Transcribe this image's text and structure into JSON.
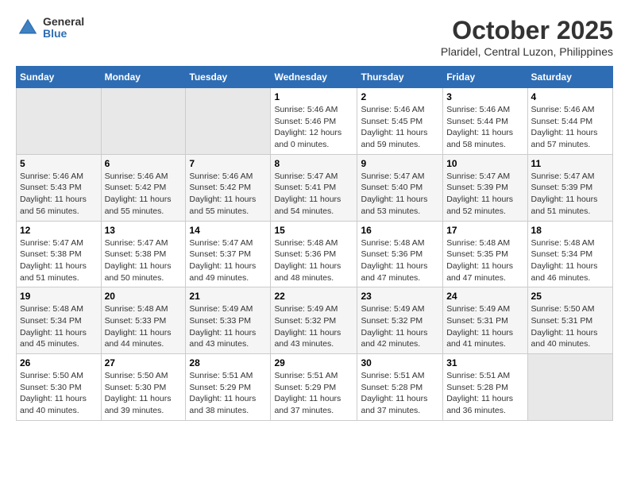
{
  "header": {
    "logo_general": "General",
    "logo_blue": "Blue",
    "month_title": "October 2025",
    "subtitle": "Plaridel, Central Luzon, Philippines"
  },
  "days_of_week": [
    "Sunday",
    "Monday",
    "Tuesday",
    "Wednesday",
    "Thursday",
    "Friday",
    "Saturday"
  ],
  "weeks": [
    [
      {
        "day": "",
        "info": ""
      },
      {
        "day": "",
        "info": ""
      },
      {
        "day": "",
        "info": ""
      },
      {
        "day": "1",
        "info": "Sunrise: 5:46 AM\nSunset: 5:46 PM\nDaylight: 12 hours\nand 0 minutes."
      },
      {
        "day": "2",
        "info": "Sunrise: 5:46 AM\nSunset: 5:45 PM\nDaylight: 11 hours\nand 59 minutes."
      },
      {
        "day": "3",
        "info": "Sunrise: 5:46 AM\nSunset: 5:44 PM\nDaylight: 11 hours\nand 58 minutes."
      },
      {
        "day": "4",
        "info": "Sunrise: 5:46 AM\nSunset: 5:44 PM\nDaylight: 11 hours\nand 57 minutes."
      }
    ],
    [
      {
        "day": "5",
        "info": "Sunrise: 5:46 AM\nSunset: 5:43 PM\nDaylight: 11 hours\nand 56 minutes."
      },
      {
        "day": "6",
        "info": "Sunrise: 5:46 AM\nSunset: 5:42 PM\nDaylight: 11 hours\nand 55 minutes."
      },
      {
        "day": "7",
        "info": "Sunrise: 5:46 AM\nSunset: 5:42 PM\nDaylight: 11 hours\nand 55 minutes."
      },
      {
        "day": "8",
        "info": "Sunrise: 5:47 AM\nSunset: 5:41 PM\nDaylight: 11 hours\nand 54 minutes."
      },
      {
        "day": "9",
        "info": "Sunrise: 5:47 AM\nSunset: 5:40 PM\nDaylight: 11 hours\nand 53 minutes."
      },
      {
        "day": "10",
        "info": "Sunrise: 5:47 AM\nSunset: 5:39 PM\nDaylight: 11 hours\nand 52 minutes."
      },
      {
        "day": "11",
        "info": "Sunrise: 5:47 AM\nSunset: 5:39 PM\nDaylight: 11 hours\nand 51 minutes."
      }
    ],
    [
      {
        "day": "12",
        "info": "Sunrise: 5:47 AM\nSunset: 5:38 PM\nDaylight: 11 hours\nand 51 minutes."
      },
      {
        "day": "13",
        "info": "Sunrise: 5:47 AM\nSunset: 5:38 PM\nDaylight: 11 hours\nand 50 minutes."
      },
      {
        "day": "14",
        "info": "Sunrise: 5:47 AM\nSunset: 5:37 PM\nDaylight: 11 hours\nand 49 minutes."
      },
      {
        "day": "15",
        "info": "Sunrise: 5:48 AM\nSunset: 5:36 PM\nDaylight: 11 hours\nand 48 minutes."
      },
      {
        "day": "16",
        "info": "Sunrise: 5:48 AM\nSunset: 5:36 PM\nDaylight: 11 hours\nand 47 minutes."
      },
      {
        "day": "17",
        "info": "Sunrise: 5:48 AM\nSunset: 5:35 PM\nDaylight: 11 hours\nand 47 minutes."
      },
      {
        "day": "18",
        "info": "Sunrise: 5:48 AM\nSunset: 5:34 PM\nDaylight: 11 hours\nand 46 minutes."
      }
    ],
    [
      {
        "day": "19",
        "info": "Sunrise: 5:48 AM\nSunset: 5:34 PM\nDaylight: 11 hours\nand 45 minutes."
      },
      {
        "day": "20",
        "info": "Sunrise: 5:48 AM\nSunset: 5:33 PM\nDaylight: 11 hours\nand 44 minutes."
      },
      {
        "day": "21",
        "info": "Sunrise: 5:49 AM\nSunset: 5:33 PM\nDaylight: 11 hours\nand 43 minutes."
      },
      {
        "day": "22",
        "info": "Sunrise: 5:49 AM\nSunset: 5:32 PM\nDaylight: 11 hours\nand 43 minutes."
      },
      {
        "day": "23",
        "info": "Sunrise: 5:49 AM\nSunset: 5:32 PM\nDaylight: 11 hours\nand 42 minutes."
      },
      {
        "day": "24",
        "info": "Sunrise: 5:49 AM\nSunset: 5:31 PM\nDaylight: 11 hours\nand 41 minutes."
      },
      {
        "day": "25",
        "info": "Sunrise: 5:50 AM\nSunset: 5:31 PM\nDaylight: 11 hours\nand 40 minutes."
      }
    ],
    [
      {
        "day": "26",
        "info": "Sunrise: 5:50 AM\nSunset: 5:30 PM\nDaylight: 11 hours\nand 40 minutes."
      },
      {
        "day": "27",
        "info": "Sunrise: 5:50 AM\nSunset: 5:30 PM\nDaylight: 11 hours\nand 39 minutes."
      },
      {
        "day": "28",
        "info": "Sunrise: 5:51 AM\nSunset: 5:29 PM\nDaylight: 11 hours\nand 38 minutes."
      },
      {
        "day": "29",
        "info": "Sunrise: 5:51 AM\nSunset: 5:29 PM\nDaylight: 11 hours\nand 37 minutes."
      },
      {
        "day": "30",
        "info": "Sunrise: 5:51 AM\nSunset: 5:28 PM\nDaylight: 11 hours\nand 37 minutes."
      },
      {
        "day": "31",
        "info": "Sunrise: 5:51 AM\nSunset: 5:28 PM\nDaylight: 11 hours\nand 36 minutes."
      },
      {
        "day": "",
        "info": ""
      }
    ]
  ]
}
